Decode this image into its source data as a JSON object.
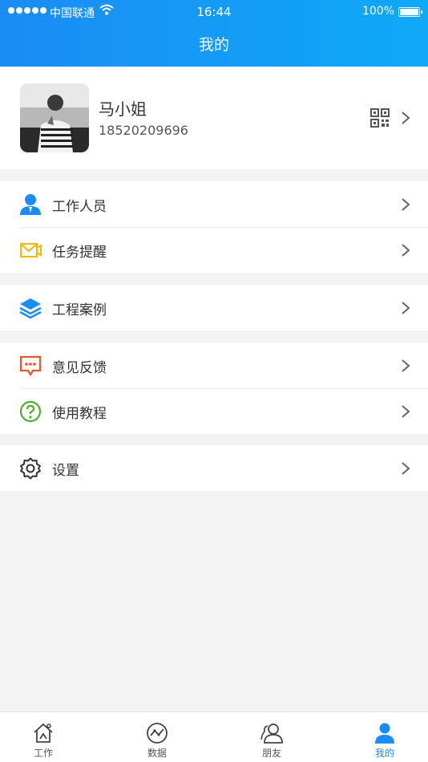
{
  "status_bar": {
    "carrier": "中国联通",
    "time": "16:44",
    "battery": "100%"
  },
  "header": {
    "title": "我的"
  },
  "profile": {
    "name": "马小姐",
    "phone": "18520209696"
  },
  "menu": [
    {
      "label": "工作人员",
      "icon": "staff-icon",
      "color": "#1a8cf5"
    },
    {
      "label": "任务提醒",
      "icon": "task-reminder-icon",
      "color": "#f5b800"
    },
    {
      "label": "工程案例",
      "icon": "layers-icon",
      "color": "#1a8cf5"
    },
    {
      "label": "意见反馈",
      "icon": "feedback-icon",
      "color": "#e8542b"
    },
    {
      "label": "使用教程",
      "icon": "help-icon",
      "color": "#4caf2a"
    },
    {
      "label": "设置",
      "icon": "gear-icon",
      "color": "#333333"
    }
  ],
  "tabs": [
    {
      "label": "工作",
      "icon": "work-house-icon"
    },
    {
      "label": "数据",
      "icon": "data-chart-icon"
    },
    {
      "label": "朋友",
      "icon": "friends-icon"
    },
    {
      "label": "我的",
      "icon": "me-icon",
      "active": true
    }
  ],
  "colors": {
    "accent": "#1a8cf5",
    "background": "#f3f3f3"
  }
}
